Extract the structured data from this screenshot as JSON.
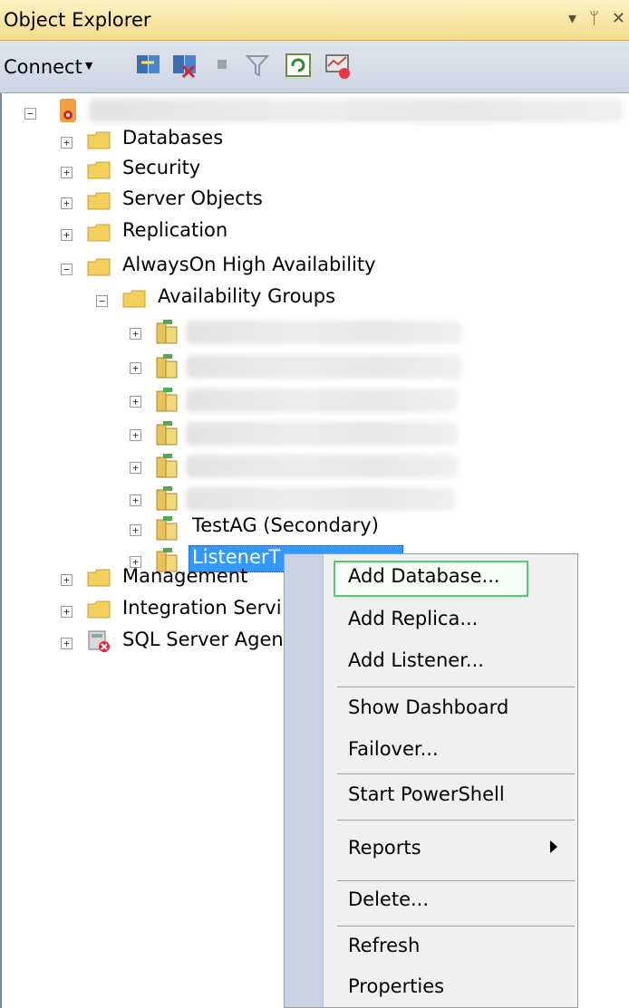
{
  "window": {
    "title": "Object Explorer",
    "controls": [
      "▾",
      "ꟷ",
      "×"
    ]
  },
  "toolbar": {
    "connect_label": "Connect",
    "icons": [
      "connect-object-explorer-icon",
      "disconnect-icon",
      "stop-icon",
      "filter-icon",
      "refresh-icon",
      "activity-monitor-icon"
    ]
  },
  "tree": {
    "server_label": "",
    "items": {
      "databases": "Databases",
      "security": "Security",
      "server_objects": "Server Objects",
      "replication": "Replication",
      "alwayson": "AlwaysOn High Availability",
      "availability_groups": "Availability Groups",
      "testag": "TestAG (Secondary)",
      "listener": "ListenerT",
      "management": "Management",
      "integration": "Integration Servi",
      "sql_agent": "SQL Server Agen"
    }
  },
  "context_menu": {
    "add_database": "Add Database...",
    "add_replica": "Add Replica...",
    "add_listener": "Add Listener...",
    "show_dashboard": "Show Dashboard",
    "failover": "Failover...",
    "start_powershell": "Start PowerShell",
    "reports": "Reports",
    "delete": "Delete...",
    "refresh": "Refresh",
    "properties": "Properties"
  },
  "colors": {
    "highlight_box": "#4fcf6b",
    "selection": "#3399ff",
    "folder": "#f3cf5b"
  }
}
